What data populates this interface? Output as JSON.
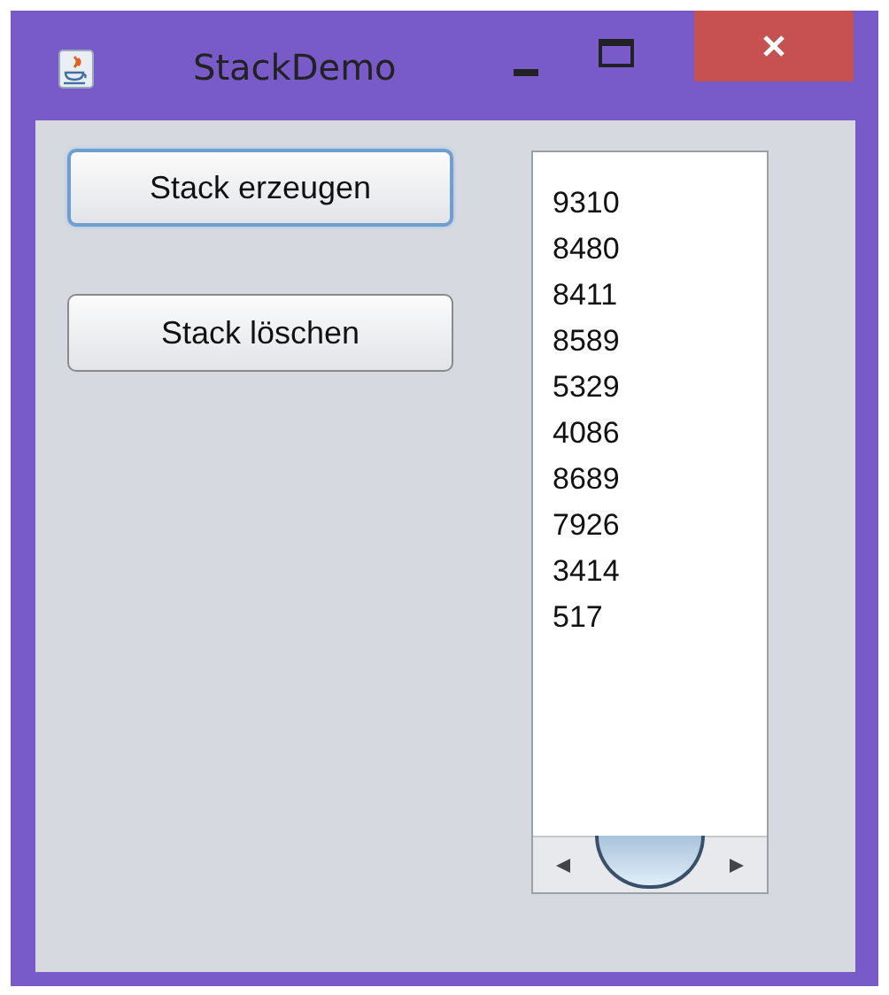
{
  "window": {
    "title": "StackDemo"
  },
  "buttons": [
    {
      "label": "Stack erzeugen",
      "focused": true
    },
    {
      "label": "Stack löschen",
      "focused": false
    }
  ],
  "list": {
    "items": [
      "9310",
      "8480",
      "8411",
      "8589",
      "5329",
      "4086",
      "8689",
      "7926",
      "3414",
      "517"
    ]
  }
}
